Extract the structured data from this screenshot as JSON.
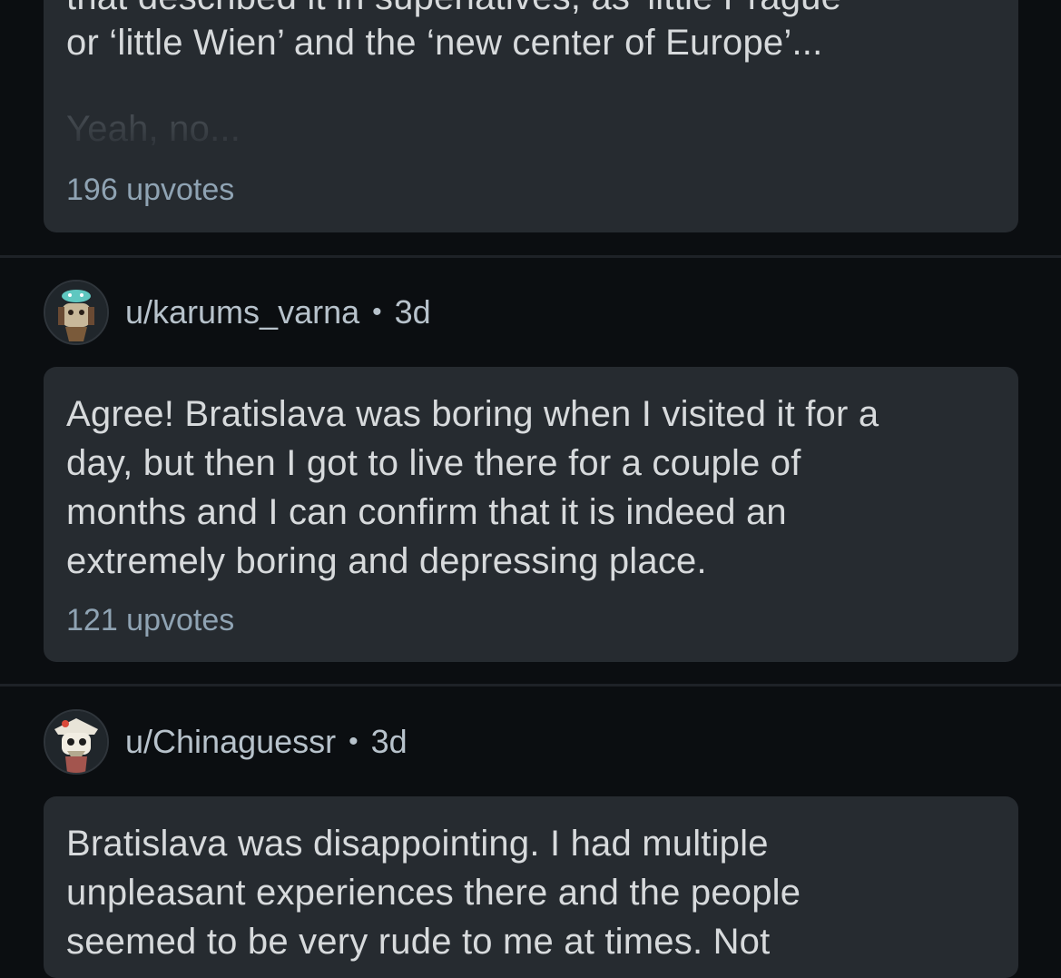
{
  "comments": [
    {
      "body_lines": [
        "that described it in superlatives, as 'little Prague'",
        "or ‘little Wien’ and the ‘new center of Europe’..."
      ],
      "truncated_line": "Yeah, no...",
      "upvotes": "196 upvotes"
    },
    {
      "username": "u/karums_varna",
      "age": "3d",
      "separator": "•",
      "avatar_icon": "snoo-avatar-icon",
      "body_lines": [
        "Agree! Bratislava was boring when I visited it for a",
        "day, but then I got to live there for a couple of",
        "months and I can confirm that it is indeed an",
        "extremely boring and depressing place."
      ],
      "upvotes": "121 upvotes"
    },
    {
      "username": "u/Chinaguessr",
      "age": "3d",
      "separator": "•",
      "avatar_icon": "snoo-avatar-icon",
      "body_lines": [
        "Bratislava was disappointing. I had multiple",
        "unpleasant experiences there and the people",
        "seemed to be very rude to me at times. Not"
      ]
    }
  ],
  "colors": {
    "background": "#0b0e11",
    "card": "#262b30",
    "text": "#d7dadc",
    "muted": "#8fa3b3"
  }
}
